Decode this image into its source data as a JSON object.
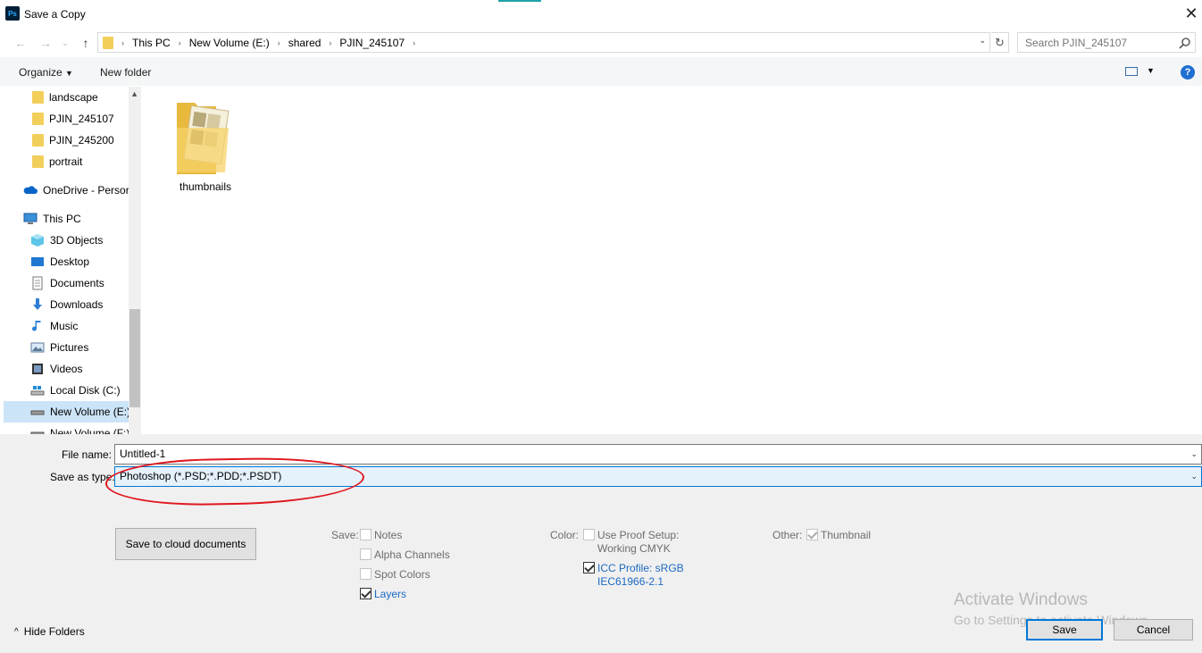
{
  "window": {
    "title": "Save a Copy",
    "app_icon": "Ps"
  },
  "address": {
    "crumbs": [
      "This PC",
      "New Volume (E:)",
      "shared",
      "PJIN_245107"
    ],
    "search_placeholder": "Search PJIN_245107"
  },
  "toolbar": {
    "organize": "Organize",
    "new_folder": "New folder",
    "help": "?"
  },
  "sidebar": {
    "items": [
      {
        "label": "landscape",
        "icon": "folder-icon"
      },
      {
        "label": "PJIN_245107",
        "icon": "folder-icon"
      },
      {
        "label": "PJIN_245200",
        "icon": "folder-icon"
      },
      {
        "label": "portrait",
        "icon": "folder-icon"
      },
      {
        "label": "OneDrive - Persor",
        "icon": "cloud-icon"
      },
      {
        "label": "This PC",
        "icon": "computer-icon"
      },
      {
        "label": "3D Objects",
        "icon": "cube-icon"
      },
      {
        "label": "Desktop",
        "icon": "desktop-icon"
      },
      {
        "label": "Documents",
        "icon": "document-icon"
      },
      {
        "label": "Downloads",
        "icon": "download-icon"
      },
      {
        "label": "Music",
        "icon": "music-icon"
      },
      {
        "label": "Pictures",
        "icon": "pictures-icon"
      },
      {
        "label": "Videos",
        "icon": "video-icon"
      },
      {
        "label": "Local Disk (C:)",
        "icon": "disk-icon"
      },
      {
        "label": "New Volume (E:)",
        "icon": "drive-icon"
      },
      {
        "label": "New Volume (F:)",
        "icon": "drive-icon"
      }
    ]
  },
  "content": {
    "items": [
      {
        "label": "thumbnails",
        "icon": "folder-icon"
      }
    ]
  },
  "form": {
    "file_name_label": "File name:",
    "file_name_value": "Untitled-1",
    "type_label": "Save as type:",
    "type_value": "Photoshop (*.PSD;*.PDD;*.PSDT)"
  },
  "cloud_button": "Save to cloud documents",
  "options": {
    "save_label": "Save:",
    "notes": "Notes",
    "alpha": "Alpha Channels",
    "spot": "Spot Colors",
    "layers": "Layers",
    "color_label": "Color:",
    "proof_line1": "Use Proof Setup:",
    "proof_line2": "Working CMYK",
    "icc_line1": "ICC Profile:  sRGB",
    "icc_line2": "IEC61966-2.1",
    "other_label": "Other:",
    "thumbnail": "Thumbnail"
  },
  "watermark": {
    "line1": "Activate Windows",
    "line2": "Go to Settings to activate Windows."
  },
  "footer": {
    "hide_folders": "Hide Folders",
    "save": "Save",
    "cancel": "Cancel"
  },
  "colors": {
    "accent": "#0078d7",
    "selection": "#cce4f7",
    "annotation": "#e0161e"
  }
}
